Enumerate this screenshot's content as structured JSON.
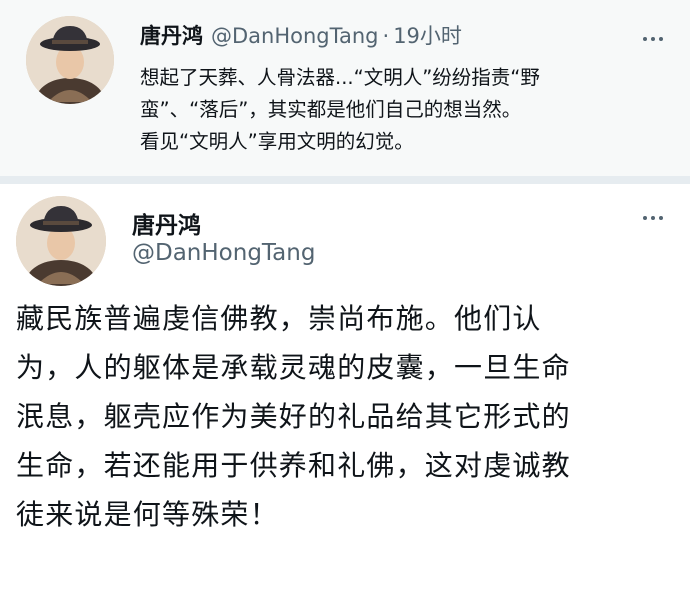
{
  "tweet_top": {
    "author_name": "唐丹鸿",
    "handle": "@DanHongTang",
    "separator": "·",
    "time": "19小时",
    "lines": [
      "想起了天葬、人骨法器...“文明人”纷纷指责“野",
      "蛮”、“落后”，其实都是他们自己的想当然。",
      "看见“文明人”享用文明的幻觉。"
    ]
  },
  "tweet_main": {
    "author_name": "唐丹鸿",
    "handle": "@DanHongTang",
    "lines": [
      "藏民族普遍虔信佛教，崇尚布施。他们认",
      "为，人的躯体是承载灵魂的皮囊，一旦生命",
      "泯息，躯壳应作为美好的礼品给其它形式的",
      "生命，若还能用于供养和礼佛，这对虔诚教",
      "徒来说是何等殊荣！"
    ]
  },
  "icons": {
    "avatar": "profile-photo-woman-with-hat",
    "more": "more-horizontal-icon"
  },
  "colors": {
    "text_primary": "#0f1419",
    "text_secondary": "#536471",
    "top_background": "#f7f9f9",
    "divider": "#e6ecf0"
  }
}
